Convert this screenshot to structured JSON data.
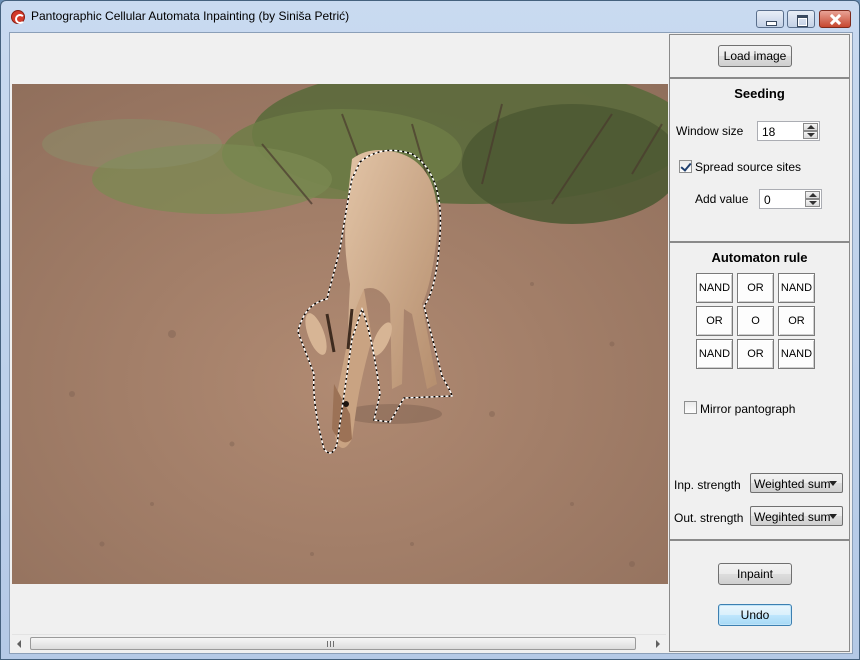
{
  "window": {
    "title": "Pantographic Cellular Automata Inpainting (by Siniša Petrić)"
  },
  "toolbar": {
    "load_label": "Load image"
  },
  "seeding": {
    "title": "Seeding",
    "window_size_label": "Window size",
    "window_size_value": "18",
    "spread_label": "Spread source sites",
    "spread_checked": true,
    "add_value_label": "Add value",
    "add_value_value": "0"
  },
  "automaton": {
    "title": "Automaton rule",
    "cells": [
      "NAND",
      "OR",
      "NAND",
      "OR",
      "O",
      "OR",
      "NAND",
      "OR",
      "NAND"
    ],
    "mirror_label": "Mirror pantograph",
    "mirror_checked": false,
    "inp_label": "Inp. strength",
    "inp_value": "Weighted sum",
    "out_label": "Out. strength",
    "out_value": "Wegihted sum"
  },
  "actions": {
    "inpaint_label": "Inpaint",
    "undo_label": "Undo"
  },
  "colors": {
    "window_frame": "#b4c9e6",
    "client_bg": "#f0f0f0",
    "selection_outline": "#000000",
    "ground": "#a27e68",
    "close_button": "#c7472f"
  },
  "icons": [
    "app-icon",
    "minimize-icon",
    "maximize-icon",
    "close-icon",
    "spin-up-icon",
    "spin-down-icon",
    "dropdown-arrow-icon",
    "scroll-left-icon",
    "scroll-right-icon"
  ]
}
